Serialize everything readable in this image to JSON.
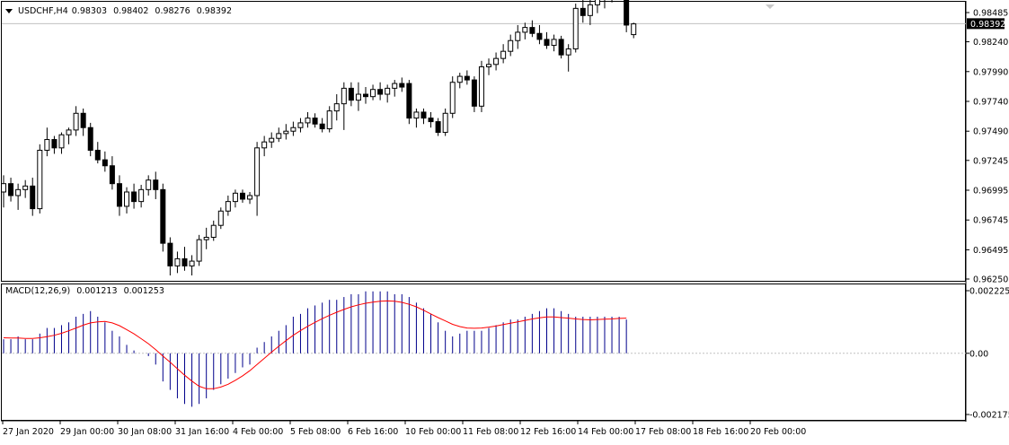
{
  "header": {
    "symbol": "USDCHF,H4",
    "open": "0.98303",
    "high": "0.98402",
    "low": "0.98276",
    "close": "0.98392"
  },
  "price_axis": {
    "ticks": [
      "0.98485",
      "0.98240",
      "0.97990",
      "0.97740",
      "0.97490",
      "0.97245",
      "0.96995",
      "0.96745",
      "0.96495",
      "0.96250"
    ],
    "current_price": "0.98392"
  },
  "macd": {
    "label": "MACD(12,26,9)",
    "main_value": "0.001213",
    "signal_value": "0.001253",
    "axis_ticks": [
      "0.002225",
      "0.00",
      "-0.002175"
    ],
    "histogram_color": "#00008B",
    "signal_color": "#FF0000"
  },
  "time_axis": {
    "labels": [
      "27 Jan 2020",
      "29 Jan 00:00",
      "30 Jan 08:00",
      "31 Jan 16:00",
      "4 Feb 00:00",
      "5 Feb 08:00",
      "6 Feb 16:00",
      "10 Feb 00:00",
      "11 Feb 08:00",
      "12 Feb 16:00",
      "14 Feb 00:00",
      "17 Feb 08:00",
      "18 Feb 16:00",
      "20 Feb 00:00"
    ]
  },
  "chart_data": [
    {
      "type": "candlestick",
      "title": "USDCHF,H4",
      "ylim": [
        0.9625,
        0.98485
      ],
      "candles": [
        [
          0.9698,
          0.9712,
          0.9685,
          0.9705
        ],
        [
          0.9705,
          0.971,
          0.969,
          0.9695
        ],
        [
          0.9695,
          0.9705,
          0.9683,
          0.97
        ],
        [
          0.97,
          0.9708,
          0.9693,
          0.9703
        ],
        [
          0.9703,
          0.971,
          0.9678,
          0.9684
        ],
        [
          0.9684,
          0.9738,
          0.968,
          0.9733
        ],
        [
          0.9733,
          0.9752,
          0.9728,
          0.9742
        ],
        [
          0.9742,
          0.9745,
          0.973,
          0.9735
        ],
        [
          0.9735,
          0.9748,
          0.973,
          0.9746
        ],
        [
          0.9746,
          0.9752,
          0.9738,
          0.975
        ],
        [
          0.975,
          0.977,
          0.9745,
          0.9764
        ],
        [
          0.9764,
          0.9768,
          0.9745,
          0.9752
        ],
        [
          0.9752,
          0.9756,
          0.9728,
          0.9733
        ],
        [
          0.9733,
          0.974,
          0.9722,
          0.9725
        ],
        [
          0.9725,
          0.9732,
          0.9715,
          0.972
        ],
        [
          0.972,
          0.9728,
          0.97,
          0.9705
        ],
        [
          0.9705,
          0.9712,
          0.9678,
          0.9686
        ],
        [
          0.9686,
          0.9702,
          0.968,
          0.9698
        ],
        [
          0.9698,
          0.9705,
          0.9684,
          0.969
        ],
        [
          0.969,
          0.9704,
          0.9685,
          0.97
        ],
        [
          0.97,
          0.9712,
          0.9695,
          0.9708
        ],
        [
          0.9708,
          0.9715,
          0.9692,
          0.97
        ],
        [
          0.97,
          0.9705,
          0.9648,
          0.9655
        ],
        [
          0.9655,
          0.966,
          0.9628,
          0.9636
        ],
        [
          0.9636,
          0.9648,
          0.963,
          0.9642
        ],
        [
          0.9642,
          0.9652,
          0.9632,
          0.9636
        ],
        [
          0.9636,
          0.9645,
          0.9628,
          0.964
        ],
        [
          0.964,
          0.9662,
          0.9636,
          0.9658
        ],
        [
          0.9658,
          0.9668,
          0.965,
          0.966
        ],
        [
          0.966,
          0.9674,
          0.9657,
          0.967
        ],
        [
          0.967,
          0.9685,
          0.9667,
          0.9682
        ],
        [
          0.9682,
          0.9695,
          0.9678,
          0.969
        ],
        [
          0.969,
          0.97,
          0.9685,
          0.9697
        ],
        [
          0.9697,
          0.97,
          0.9689,
          0.9692
        ],
        [
          0.9692,
          0.9698,
          0.9688,
          0.9695
        ],
        [
          0.9695,
          0.974,
          0.9678,
          0.9735
        ],
        [
          0.9735,
          0.9745,
          0.9728,
          0.974
        ],
        [
          0.974,
          0.9748,
          0.9735,
          0.9743
        ],
        [
          0.9743,
          0.9752,
          0.974,
          0.9747
        ],
        [
          0.9747,
          0.9755,
          0.9742,
          0.9749
        ],
        [
          0.9749,
          0.9757,
          0.9745,
          0.9752
        ],
        [
          0.9752,
          0.976,
          0.9748,
          0.9756
        ],
        [
          0.9756,
          0.9765,
          0.9752,
          0.976
        ],
        [
          0.976,
          0.9764,
          0.9752,
          0.9755
        ],
        [
          0.9755,
          0.976,
          0.9748,
          0.9751
        ],
        [
          0.9751,
          0.977,
          0.9748,
          0.9766
        ],
        [
          0.9766,
          0.978,
          0.9758,
          0.9772
        ],
        [
          0.9772,
          0.979,
          0.975,
          0.9785
        ],
        [
          0.9785,
          0.979,
          0.977,
          0.9775
        ],
        [
          0.9775,
          0.979,
          0.9766,
          0.978
        ],
        [
          0.978,
          0.9786,
          0.9772,
          0.9778
        ],
        [
          0.9778,
          0.9788,
          0.9775,
          0.9784
        ],
        [
          0.9784,
          0.979,
          0.9775,
          0.978
        ],
        [
          0.978,
          0.9788,
          0.9773,
          0.9785
        ],
        [
          0.9785,
          0.9792,
          0.9778,
          0.9789
        ],
        [
          0.9789,
          0.9794,
          0.9782,
          0.9786
        ],
        [
          0.9789,
          0.9792,
          0.9755,
          0.976
        ],
        [
          0.976,
          0.9768,
          0.9752,
          0.9765
        ],
        [
          0.9765,
          0.9768,
          0.9755,
          0.976
        ],
        [
          0.976,
          0.9765,
          0.9752,
          0.9757
        ],
        [
          0.9757,
          0.976,
          0.9745,
          0.9748
        ],
        [
          0.9748,
          0.9768,
          0.9745,
          0.9764
        ],
        [
          0.9764,
          0.9795,
          0.976,
          0.979
        ],
        [
          0.979,
          0.9798,
          0.9785,
          0.9795
        ],
        [
          0.9795,
          0.98,
          0.9788,
          0.9792
        ],
        [
          0.9792,
          0.9795,
          0.9765,
          0.977
        ],
        [
          0.977,
          0.9808,
          0.9765,
          0.9803
        ],
        [
          0.9803,
          0.981,
          0.9796,
          0.9805
        ],
        [
          0.9805,
          0.9815,
          0.98,
          0.981
        ],
        [
          0.981,
          0.9822,
          0.9806,
          0.9816
        ],
        [
          0.9816,
          0.983,
          0.9812,
          0.9825
        ],
        [
          0.9825,
          0.9838,
          0.9818,
          0.9832
        ],
        [
          0.9832,
          0.984,
          0.9826,
          0.9836
        ],
        [
          0.9836,
          0.9842,
          0.9828,
          0.9831
        ],
        [
          0.9831,
          0.9838,
          0.9822,
          0.9826
        ],
        [
          0.9826,
          0.9832,
          0.9818,
          0.9821
        ],
        [
          0.9821,
          0.983,
          0.9816,
          0.9826
        ],
        [
          0.9826,
          0.9829,
          0.981,
          0.9813
        ],
        [
          0.9813,
          0.9822,
          0.9799,
          0.9818
        ],
        [
          0.9818,
          0.9856,
          0.9815,
          0.9852
        ],
        [
          0.9852,
          0.9866,
          0.984,
          0.9846
        ],
        [
          0.9846,
          0.986,
          0.9838,
          0.9855
        ],
        [
          0.9855,
          0.9866,
          0.9848,
          0.986
        ],
        [
          0.986,
          0.987,
          0.9852,
          0.9865
        ],
        [
          0.9865,
          0.9872,
          0.9857,
          0.9868
        ],
        [
          0.9868,
          0.9873,
          0.986,
          0.9861
        ],
        [
          0.9861,
          0.9866,
          0.9832,
          0.9838
        ],
        [
          0.983,
          0.984,
          0.9827,
          0.9839
        ]
      ]
    },
    {
      "type": "bar+line",
      "title": "MACD(12,26,9)",
      "ylim": [
        -0.002175,
        0.002225
      ],
      "histogram": [
        0.0005,
        0.0005,
        0.0006,
        0.0005,
        0.0005,
        0.0007,
        0.0009,
        0.0009,
        0.001,
        0.0011,
        0.0013,
        0.0014,
        0.0015,
        0.0013,
        0.0011,
        0.0008,
        0.0006,
        0.0003,
        0.0001,
        0.0,
        -0.0001,
        -0.0004,
        -0.001,
        -0.0013,
        -0.0016,
        -0.0018,
        -0.0019,
        -0.0018,
        -0.0016,
        -0.0013,
        -0.0011,
        -0.0009,
        -0.0007,
        -0.0005,
        -0.0004,
        0.0002,
        0.0004,
        0.0006,
        0.0008,
        0.001,
        0.0013,
        0.0014,
        0.0016,
        0.0017,
        0.0018,
        0.0019,
        0.0019,
        0.002,
        0.0021,
        0.0021,
        0.0022,
        0.0022,
        0.0022,
        0.0022,
        0.0021,
        0.0021,
        0.002,
        0.0018,
        0.0016,
        0.0014,
        0.0011,
        0.0008,
        0.0006,
        0.0007,
        0.0008,
        0.0008,
        0.0008,
        0.0009,
        0.001,
        0.0011,
        0.0012,
        0.0012,
        0.0013,
        0.0014,
        0.0015,
        0.0016,
        0.0016,
        0.0015,
        0.0014,
        0.0013,
        0.0013,
        0.0013,
        0.0013,
        0.0013,
        0.0013,
        0.0013,
        0.0012
      ],
      "signal": [
        0.00055,
        0.00054,
        0.00054,
        0.00053,
        0.00053,
        0.00055,
        0.00059,
        0.00064,
        0.00071,
        0.0008,
        0.0009,
        0.001,
        0.00108,
        0.00112,
        0.00113,
        0.00108,
        0.00098,
        0.00084,
        0.00069,
        0.00052,
        0.00034,
        0.00013,
        -0.0001,
        -0.00032,
        -0.00055,
        -0.00078,
        -0.00099,
        -0.00117,
        -0.00126,
        -0.00126,
        -0.0012,
        -0.0011,
        -0.00096,
        -0.0008,
        -0.00062,
        -0.0004,
        -0.00018,
        4e-05,
        0.00025,
        0.00045,
        0.00064,
        0.00081,
        0.00096,
        0.0011,
        0.00123,
        0.00135,
        0.00146,
        0.00156,
        0.00165,
        0.00172,
        0.00178,
        0.00182,
        0.00185,
        0.00186,
        0.00185,
        0.00181,
        0.00174,
        0.00165,
        0.00153,
        0.0014,
        0.00127,
        0.00115,
        0.00103,
        0.00095,
        0.0009,
        0.00089,
        0.0009,
        0.00093,
        0.00097,
        0.00102,
        0.00107,
        0.00112,
        0.00117,
        0.00122,
        0.00126,
        0.00129,
        0.00129,
        0.00127,
        0.00125,
        0.00122,
        0.0012,
        0.00119,
        0.0012,
        0.00121,
        0.00122,
        0.00124,
        0.00125
      ]
    }
  ]
}
